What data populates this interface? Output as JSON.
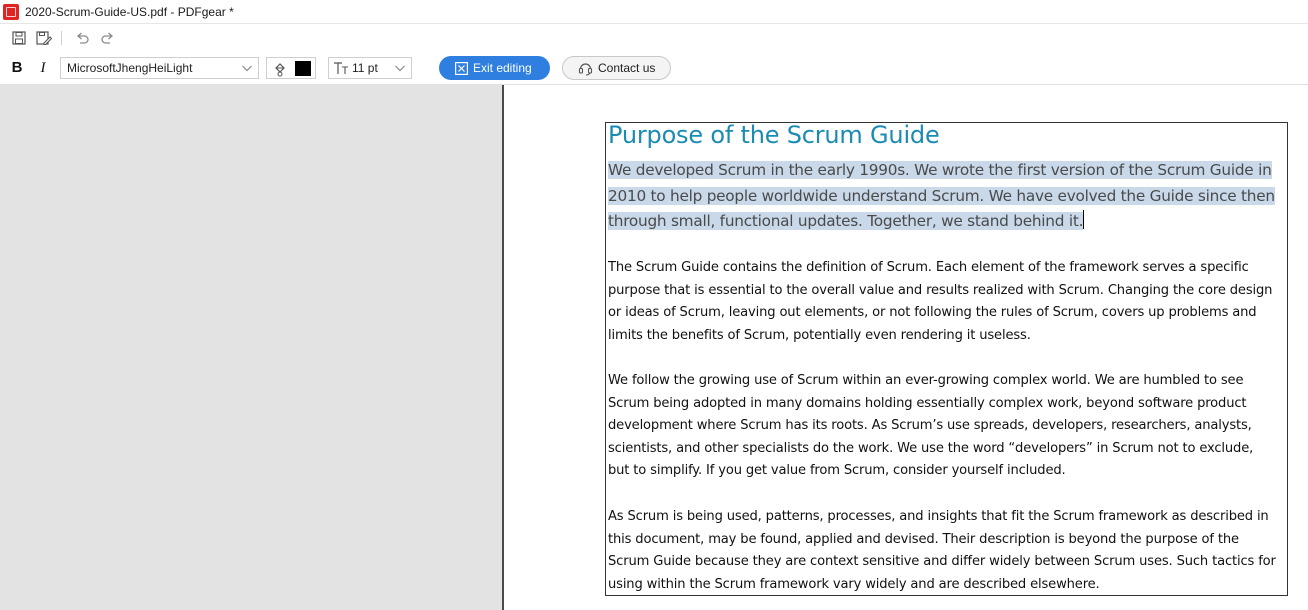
{
  "window": {
    "title": "2020-Scrum-Guide-US.pdf - PDFgear *",
    "app_logo_icon": "pdfgear-logo-icon"
  },
  "quick_toolbar": {
    "items": [
      "save-icon",
      "save-as-icon",
      "undo-icon",
      "redo-icon"
    ]
  },
  "format_toolbar": {
    "bold_label": "B",
    "italic_label": "I",
    "font_name": "MicrosoftJhengHeiLight",
    "text_color": "#000000",
    "font_size": "11 pt",
    "exit_label": "Exit editing",
    "contact_label": "Contact us",
    "accent_color": "#2f7fe0"
  },
  "document": {
    "heading": "Purpose of the Scrum Guide",
    "heading_color": "#1a8cb3",
    "selected_lines": [
      "We developed Scrum in the early 1990s. We wrote the first version of the Scrum Guide in",
      "2010 to help people worldwide understand Scrum.  We have evolved the Guide since then",
      "through small, functional updates. Together, we stand behind it."
    ],
    "paragraphs": [
      {
        "lines": [
          "The Scrum Guide contains the definition of Scrum. Each element of the framework serves a specific",
          "purpose that is essential to the overall value and results realized with Scrum. Changing the core design",
          "or ideas of Scrum, leaving out elements, or not following the rules of Scrum, covers up problems and",
          "limits the benefits of Scrum, potentially even rendering it useless."
        ]
      },
      {
        "lines": [
          "We follow the growing use of Scrum within an ever-growing complex world. We are humbled to see",
          "Scrum being adopted in many domains holding essentially complex work, beyond software product",
          "development where Scrum has its roots. As Scrum’s use spreads, developers, researchers, analysts,",
          "scientists, and other specialists do the work. We use the word “developers” in Scrum not to exclude,",
          "but to simplify. If you get value from Scrum, consider yourself included."
        ]
      },
      {
        "lines": [
          "As Scrum is being used, patterns, processes, and insights that fit the Scrum framework as described in",
          "this document, may be found, applied and devised. Their description is beyond the purpose of the",
          "Scrum Guide because they are context sensitive and differ widely between Scrum uses. Such tactics for",
          "using within the Scrum framework vary widely and are described elsewhere."
        ]
      }
    ]
  }
}
